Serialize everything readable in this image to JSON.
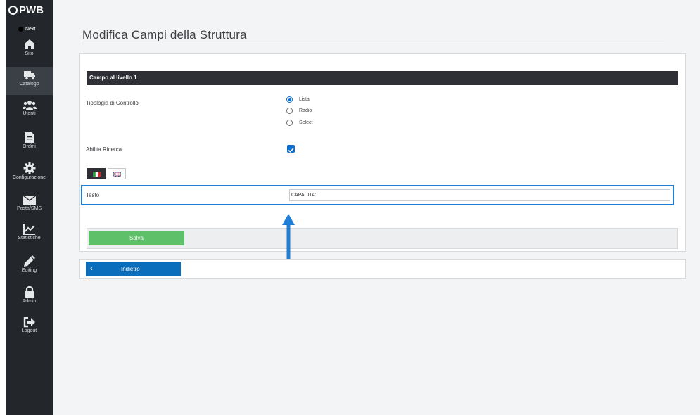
{
  "brand": {
    "name": "PWB",
    "edition": "Next"
  },
  "sidebar": {
    "items": [
      {
        "label": "Sito",
        "icon": "home-icon",
        "active": false
      },
      {
        "label": "Catalogo",
        "icon": "truck-icon",
        "active": true
      },
      {
        "label": "Utenti",
        "icon": "users-icon",
        "active": false
      },
      {
        "label": "Ordini",
        "icon": "file-icon",
        "active": false
      },
      {
        "label": "Configurazione",
        "icon": "gear-icon",
        "active": false
      },
      {
        "label": "Posta/SMS",
        "icon": "envelope-icon",
        "active": false
      },
      {
        "label": "Statistiche",
        "icon": "chart-icon",
        "active": false
      },
      {
        "label": "Editing",
        "icon": "pencil-icon",
        "active": false
      },
      {
        "label": "Admin",
        "icon": "lock-icon",
        "active": false
      },
      {
        "label": "Logout",
        "icon": "logout-icon",
        "active": false
      }
    ]
  },
  "page": {
    "title": "Modifica Campi della Struttura"
  },
  "form": {
    "section_title": "Campo al livello 1",
    "control_type": {
      "label": "Tipologia di Controllo",
      "options": [
        "Lista",
        "Radio",
        "Select"
      ],
      "selected": "Lista"
    },
    "search": {
      "label": "Abilita Ricerca",
      "checked": true
    },
    "language_tabs": [
      {
        "name": "italian",
        "icon": "italy-flag-icon",
        "active": true
      },
      {
        "name": "english",
        "icon": "uk-flag-icon",
        "active": false
      }
    ],
    "text_field": {
      "label": "Testo",
      "value": "CAPACITA'"
    },
    "save_label": "Salva"
  },
  "back": {
    "label": "Indietro"
  },
  "colors": {
    "sidebar_bg": "#23272b",
    "header_bg": "#2e3035",
    "accent_blue": "#0b6fd0",
    "save_green": "#5fc06a",
    "highlight_blue": "#1f7fd6"
  }
}
